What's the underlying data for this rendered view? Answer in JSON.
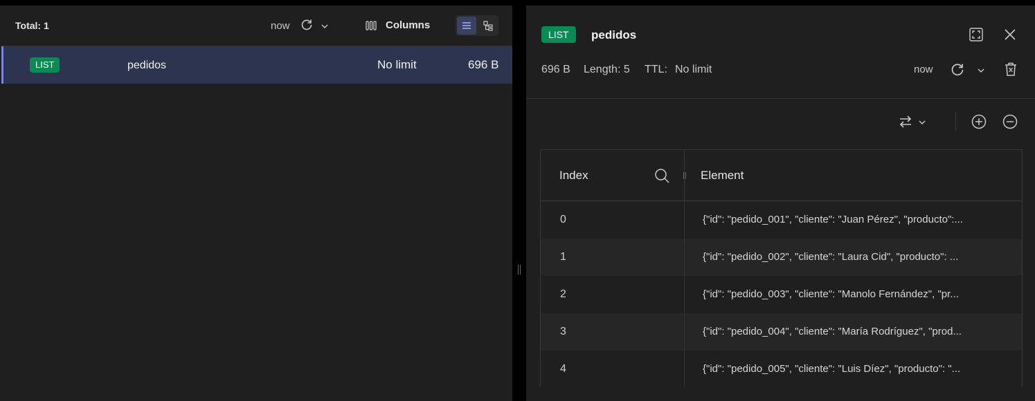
{
  "left": {
    "total_label": "Total: 1",
    "refresh_time": "now",
    "columns_label": "Columns",
    "keys": [
      {
        "type": "LIST",
        "name": "pedidos",
        "ttl": "No limit",
        "size": "696 B"
      }
    ]
  },
  "detail": {
    "type": "LIST",
    "name": "pedidos",
    "size": "696 B",
    "length": "Length: 5",
    "ttl_label": "TTL:",
    "ttl_value": "No limit",
    "refresh_time": "now",
    "table": {
      "headers": {
        "index": "Index",
        "element": "Element"
      },
      "rows": [
        {
          "index": "0",
          "element": "{\"id\": \"pedido_001\", \"cliente\": \"Juan Pérez\", \"producto\":..."
        },
        {
          "index": "1",
          "element": "{\"id\": \"pedido_002\", \"cliente\": \"Laura Cid\", \"producto\": ..."
        },
        {
          "index": "2",
          "element": "{\"id\": \"pedido_003\", \"cliente\": \"Manolo Fernández\", \"pr..."
        },
        {
          "index": "3",
          "element": "{\"id\": \"pedido_004\", \"cliente\": \"María Rodríguez\", \"prod..."
        },
        {
          "index": "4",
          "element": "{\"id\": \"pedido_005\", \"cliente\": \"Luis Díez\", \"producto\": \"..."
        }
      ]
    }
  },
  "colors": {
    "badge_list": "#0a8a55",
    "selected_row": "#2d3450",
    "selected_accent": "#7b84e6",
    "panel_bg": "#1f1f1f"
  },
  "icons": [
    "refresh-icon",
    "chevron-down-icon",
    "columns-icon",
    "list-view-icon",
    "tree-view-icon",
    "fullscreen-icon",
    "close-icon",
    "delete-icon",
    "swap-format-icon",
    "add-icon",
    "remove-icon",
    "search-icon"
  ]
}
